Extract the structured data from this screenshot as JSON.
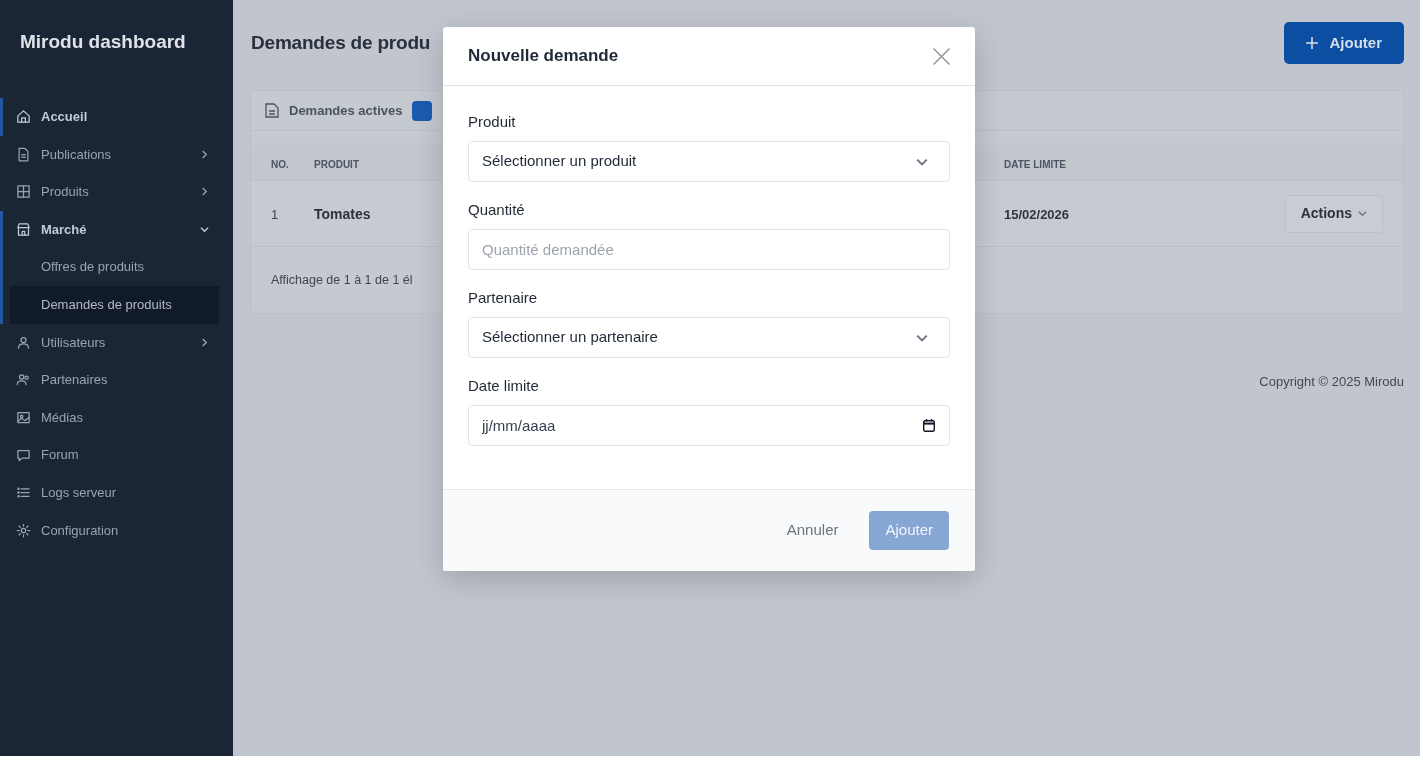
{
  "sidebar": {
    "logo": "Mirodu dashboard",
    "items": [
      {
        "label": "Accueil",
        "kind": "link",
        "active": true
      },
      {
        "label": "Publications",
        "kind": "group",
        "expanded": false,
        "active": false
      },
      {
        "label": "Produits",
        "kind": "group",
        "expanded": false,
        "active": false
      },
      {
        "label": "Marché",
        "kind": "group",
        "expanded": true,
        "active": true,
        "children": [
          {
            "label": "Offres de produits",
            "selected": false
          },
          {
            "label": "Demandes de produits",
            "selected": true
          }
        ]
      },
      {
        "label": "Utilisateurs",
        "kind": "group",
        "expanded": false,
        "active": false
      },
      {
        "label": "Partenaires",
        "kind": "link",
        "active": false
      },
      {
        "label": "Médias",
        "kind": "link",
        "active": false
      },
      {
        "label": "Forum",
        "kind": "link",
        "active": false
      },
      {
        "label": "Logs serveur",
        "kind": "link",
        "active": false
      },
      {
        "label": "Configuration",
        "kind": "link",
        "active": false
      }
    ]
  },
  "page": {
    "title": "Demandes de produ",
    "add_button": {
      "label": "Ajouter"
    }
  },
  "card": {
    "tabs": [
      {
        "label": "Demandes actives"
      }
    ],
    "table": {
      "columns": [
        "NO.",
        "PRODUIT",
        "DATE LIMITE"
      ],
      "rows": [
        {
          "no": "1",
          "produit": "Tomates",
          "date_limite": "15/02/2026",
          "action": "Actions"
        }
      ]
    },
    "footer": "Affichage de 1 à 1 de 1 él"
  },
  "copyright": "Copyright © 2025 Mirodu",
  "modal": {
    "title": "Nouvelle demande",
    "fields": [
      {
        "kind": "select",
        "label": "Produit",
        "value": "Sélectionner un produit"
      },
      {
        "kind": "text",
        "label": "Quantité",
        "placeholder": "Quantité demandée"
      },
      {
        "kind": "select",
        "label": "Partenaire",
        "value": "Sélectionner un partenaire"
      },
      {
        "kind": "date",
        "label": "Date limite",
        "placeholder": "jj/mm/aaaa"
      }
    ],
    "buttons": [
      {
        "kind": "text",
        "label": "Annuler",
        "disabled": false
      },
      {
        "kind": "primary",
        "label": "Ajouter",
        "disabled": true
      }
    ]
  }
}
